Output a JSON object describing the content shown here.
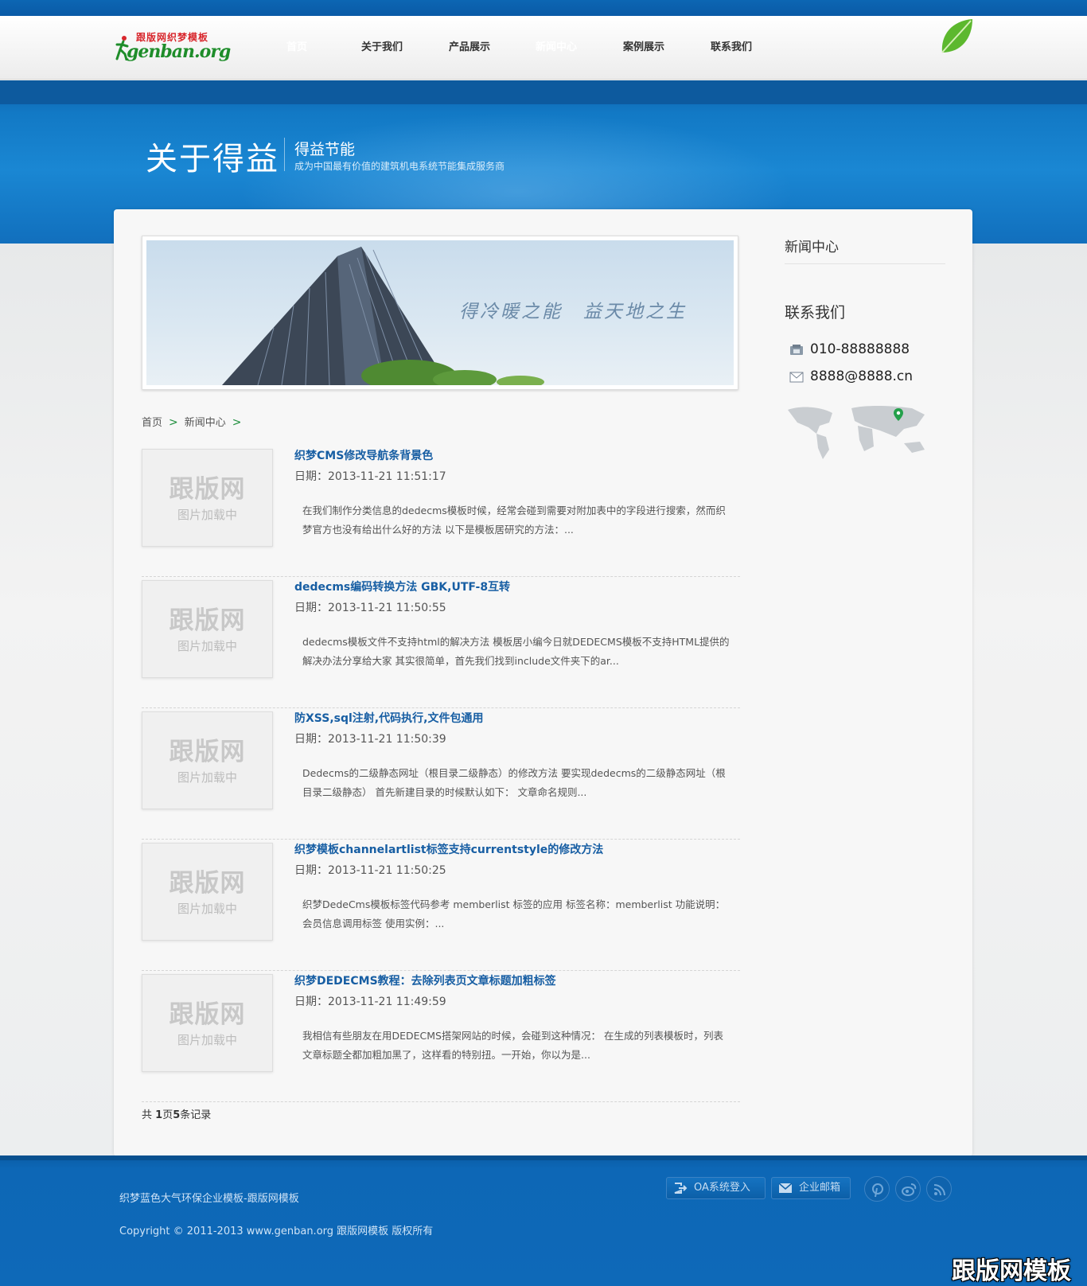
{
  "nav": {
    "logo_cn": "跟版网织梦模板",
    "logo_en": "genban.org",
    "items": [
      {
        "label": "首页",
        "active": true
      },
      {
        "label": "关于我们",
        "active": false
      },
      {
        "label": "产品展示",
        "active": false
      },
      {
        "label": "新闻中心",
        "active": true
      },
      {
        "label": "案例展示",
        "active": false
      },
      {
        "label": "联系我们",
        "active": false
      }
    ]
  },
  "banner": {
    "title": "关于得益",
    "subtitle": "得益节能",
    "tagline": "成为中国最有价值的建筑机电系统节能集成服务商"
  },
  "hero": {
    "slogan": "得冷暖之能　益天地之生"
  },
  "breadcrumb": {
    "home": "首页",
    "section": "新闻中心",
    "sep": ">"
  },
  "thumb": {
    "brand": "跟版网",
    "loading": "图片加载中"
  },
  "articles": [
    {
      "title": "织梦CMS修改导航条背景色",
      "date": "日期：2013-11-21 11:51:17",
      "desc": "在我们制作分类信息的dedecms模板时候，经常会碰到需要对附加表中的字段进行搜索，然而织梦官方也没有给出什么好的方法 以下是模板居研究的方法：..."
    },
    {
      "title": "dedecms编码转换方法 GBK,UTF-8互转",
      "date": "日期：2013-11-21 11:50:55",
      "desc": "dedecms模板文件不支持html的解决方法 模板居小编今日就DEDECMS模板不支持HTML提供的解决办法分享给大家 其实很简单，首先我们找到include文件夹下的ar..."
    },
    {
      "title": "防XSS,sql注射,代码执行,文件包通用",
      "date": "日期：2013-11-21 11:50:39",
      "desc": "Dedecms的二级静态网址（根目录二级静态）的修改方法 要实现dedecms的二级静态网址（根目录二级静态） 首先新建目录的时候默认如下： 文章命名规则..."
    },
    {
      "title": "织梦模板channelartlist标签支持currentstyle的修改方法",
      "date": "日期：2013-11-21 11:50:25",
      "desc": "织梦DedeCms模板标签代码参考 memberlist 标签的应用 标签名称：memberlist 功能说明：会员信息调用标签 使用实例：..."
    },
    {
      "title": "织梦DEDECMS教程：去除列表页文章标题加粗标签",
      "date": "日期：2013-11-21 11:49:59",
      "desc": "我相信有些朋友在用DEDECMS搭架网站的时候，会碰到这种情况： 在生成的列表模板时，列表文章标题全都加粗加黑了，这样看的特别扭。一开始，你以为是..."
    }
  ],
  "pagination": {
    "prefix": "共 ",
    "pages": "1",
    "mid": "页",
    "records": "5",
    "suffix": "条记录"
  },
  "sidebar": {
    "news_heading": "新闻中心",
    "contact_heading": "联系我们",
    "phone": "010-88888888",
    "email": "8888@8888.cn"
  },
  "footer": {
    "site_name": "织梦蓝色大气环保企业模板-跟版网模板",
    "copyright": "Copyright © 2011-2013 www.genban.org 跟版网模板 版权所有",
    "oa_button": "OA系统登入",
    "mail_button": "企业邮箱"
  },
  "watermark": "跟版网模板",
  "colors": {
    "brand_blue": "#0c66b3",
    "link_blue": "#175ea3",
    "accent_green": "#1c8e3b"
  }
}
